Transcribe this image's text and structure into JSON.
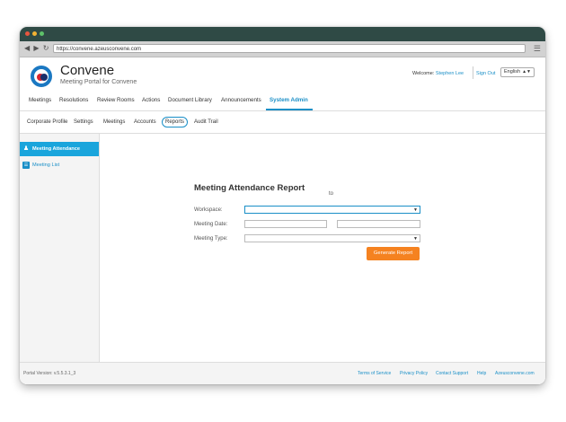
{
  "browser": {
    "url": "https://convene.azeusconvene.com",
    "dots": [
      "#e8563f",
      "#f2b233",
      "#5ec26a"
    ]
  },
  "app": {
    "brand": "Convene",
    "tagline": "Meeting Portal for Convene",
    "welcome_label": "Welcome:",
    "user_name": "Stephen Lee",
    "sign_out": "Sign Out",
    "language": "English"
  },
  "main_nav": [
    "Meetings",
    "Resolutions",
    "Review Rooms",
    "Actions",
    "Document Library",
    "Announcements",
    "System Admin"
  ],
  "sub_nav": [
    "Corporate Profile",
    "Settings",
    "Meetings",
    "Accounts",
    "Reports",
    "Audit Trail"
  ],
  "sidebar": [
    {
      "label": "Meeting Attendance",
      "icon": "user-icon",
      "active": true
    },
    {
      "label": "Meeting List",
      "icon": "list-icon",
      "active": false
    }
  ],
  "report": {
    "title": "Meeting Attendance Report",
    "workspace_label": "Workspace:",
    "workspace_value": "",
    "meeting_date_label": "Meeting Date:",
    "date_from": "",
    "to_label": "to",
    "date_to": "",
    "meeting_type_label": "Meeting Type:",
    "meeting_type_value": "",
    "generate_button": "Generate Report"
  },
  "footer": {
    "version": "Portal Version: v.5.5.3.1_3",
    "links": [
      "Terms of Service",
      "Privacy Policy",
      "Contact Support",
      "Help",
      "Azeusconvene.com"
    ]
  },
  "colors": {
    "accent": "#1a8fc7",
    "button": "#f58220",
    "titlebar": "#2f4a45",
    "sidebar_active": "#1aa5dc"
  }
}
